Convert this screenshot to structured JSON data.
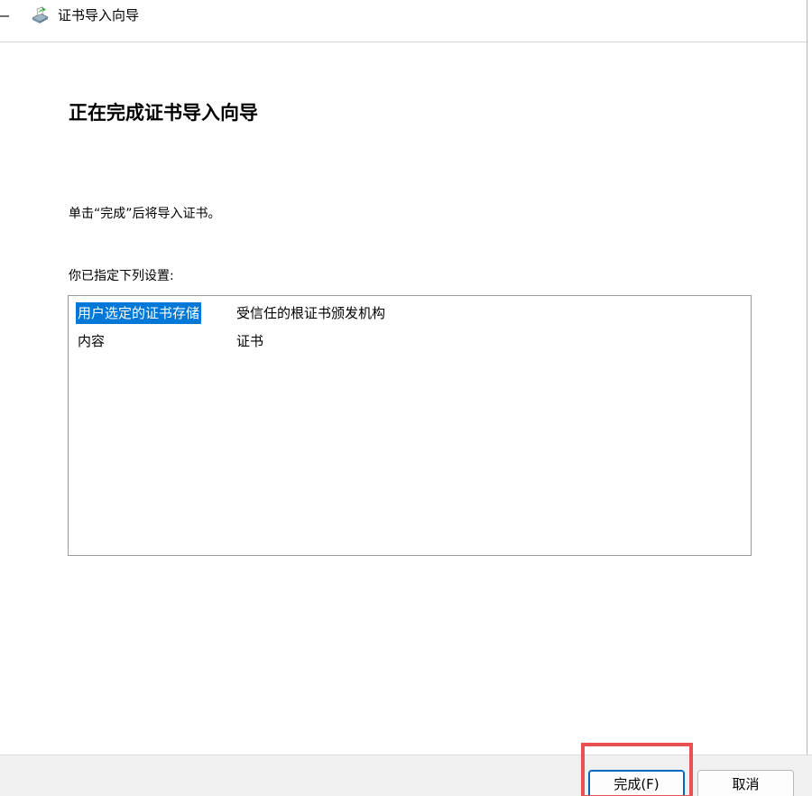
{
  "titlebar": {
    "title": "证书导入向导",
    "back_icon": "back-arrow-icon",
    "app_icon": "certificate-wizard-icon"
  },
  "main": {
    "heading": "正在完成证书导入向导",
    "instruction": "单击“完成”后将导入证书。",
    "settings_label": "你已指定下列设置:",
    "settings": [
      {
        "key": "用户选定的证书存储",
        "value": "受信任的根证书颁发机构",
        "selected": true
      },
      {
        "key": "内容",
        "value": "证书",
        "selected": false
      }
    ]
  },
  "footer": {
    "finish_label": "完成(F)",
    "cancel_label": "取消"
  },
  "colors": {
    "selection": "#0078d7",
    "highlight": "#e8524f",
    "footer_bg": "#f0f0f0"
  }
}
